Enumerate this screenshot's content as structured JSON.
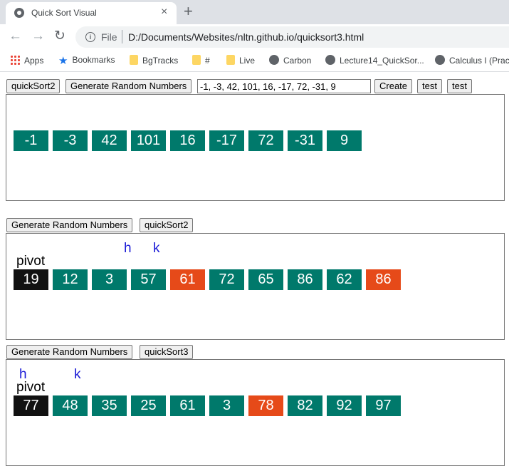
{
  "browser": {
    "tab_title": "Quick Sort Visual",
    "tab_close": "×",
    "new_tab": "+",
    "back": "←",
    "forward": "→",
    "reload": "↻",
    "info": "i",
    "url_scheme": "File",
    "url": "D:/Documents/Websites/nltn.github.io/quicksort3.html"
  },
  "bookmarks": [
    {
      "label": "Apps",
      "icon": "apps-icon"
    },
    {
      "label": "Bookmarks",
      "icon": "star-icon"
    },
    {
      "label": "BgTracks",
      "icon": "folder-icon"
    },
    {
      "label": "#",
      "icon": "folder-icon"
    },
    {
      "label": "Live",
      "icon": "folder-icon"
    },
    {
      "label": "Carbon",
      "icon": "globe-icon"
    },
    {
      "label": "Lecture14_QuickSor...",
      "icon": "globe-icon"
    },
    {
      "label": "Calculus I (Pract",
      "icon": "globe-icon"
    }
  ],
  "section1": {
    "quicksort_button": "quickSort2",
    "generate_button": "Generate Random Numbers",
    "input_value": "-1, -3, 42, 101, 16, -17, 72, -31, 9",
    "create_button": "Create",
    "test_button_1": "test",
    "test_button_2": "test",
    "cells": [
      {
        "value": "-1",
        "color": "teal"
      },
      {
        "value": "-3",
        "color": "teal"
      },
      {
        "value": "42",
        "color": "teal"
      },
      {
        "value": "101",
        "color": "teal"
      },
      {
        "value": "16",
        "color": "teal"
      },
      {
        "value": "-17",
        "color": "teal"
      },
      {
        "value": "72",
        "color": "teal"
      },
      {
        "value": "-31",
        "color": "teal"
      },
      {
        "value": "9",
        "color": "teal"
      }
    ]
  },
  "section2": {
    "generate_button": "Generate Random Numbers",
    "quicksort_button": "quickSort2",
    "pivot_label": "pivot",
    "marker_h": "h",
    "marker_k": "k",
    "cells": [
      {
        "value": "19",
        "color": "black"
      },
      {
        "value": "12",
        "color": "teal"
      },
      {
        "value": "3",
        "color": "teal"
      },
      {
        "value": "57",
        "color": "teal"
      },
      {
        "value": "61",
        "color": "orange"
      },
      {
        "value": "72",
        "color": "teal"
      },
      {
        "value": "65",
        "color": "teal"
      },
      {
        "value": "86",
        "color": "teal"
      },
      {
        "value": "62",
        "color": "teal"
      },
      {
        "value": "86",
        "color": "orange"
      }
    ]
  },
  "section3": {
    "generate_button": "Generate Random Numbers",
    "quicksort_button": "quickSort3",
    "pivot_label": "pivot",
    "marker_h": "h",
    "marker_k": "k",
    "cells": [
      {
        "value": "77",
        "color": "black"
      },
      {
        "value": "48",
        "color": "teal"
      },
      {
        "value": "35",
        "color": "teal"
      },
      {
        "value": "25",
        "color": "teal"
      },
      {
        "value": "61",
        "color": "teal"
      },
      {
        "value": "3",
        "color": "teal"
      },
      {
        "value": "78",
        "color": "orange"
      },
      {
        "value": "82",
        "color": "teal"
      },
      {
        "value": "92",
        "color": "teal"
      },
      {
        "value": "97",
        "color": "teal"
      }
    ]
  },
  "colors": {
    "teal": "#00796b",
    "black": "#111111",
    "orange": "#e64a19",
    "marker": "#1a1ad6"
  }
}
